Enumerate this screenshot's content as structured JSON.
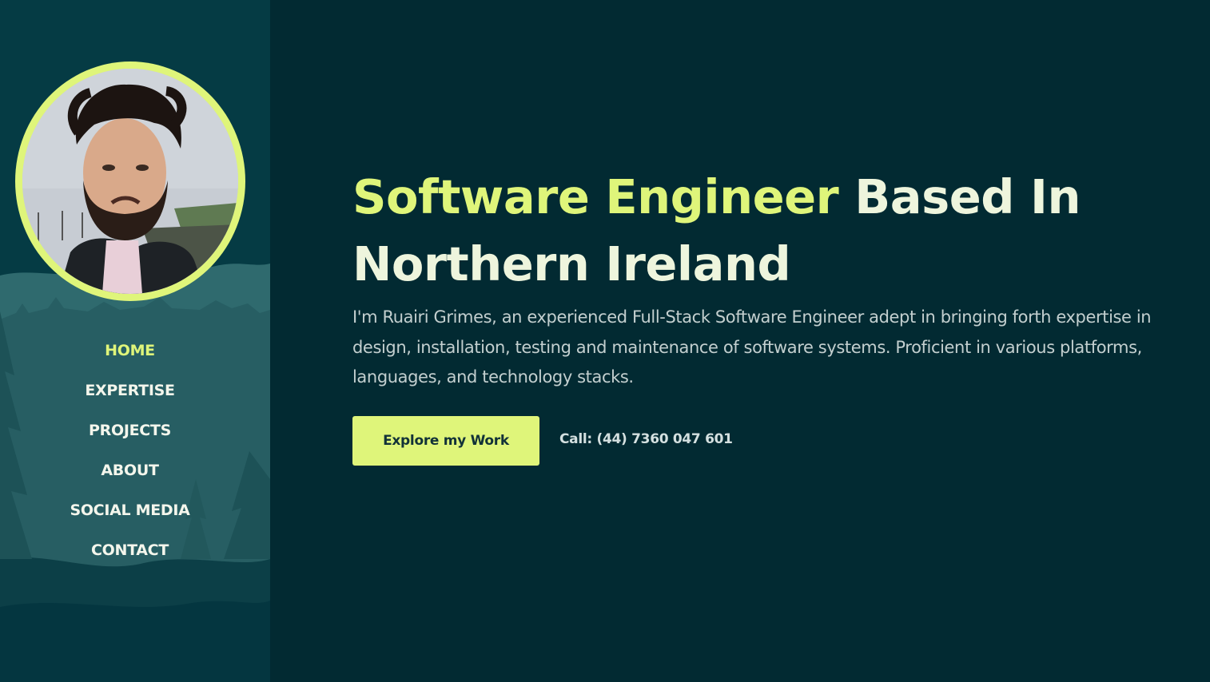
{
  "colors": {
    "background": "#022a32",
    "sidebar": "#053b44",
    "accent": "#dff57a",
    "headline_text": "#eef5dd",
    "body_text": "#c3cfcf"
  },
  "nav": {
    "items": [
      {
        "label": "HOME",
        "active": true
      },
      {
        "label": "EXPERTISE"
      },
      {
        "label": "PROJECTS"
      },
      {
        "label": "ABOUT"
      },
      {
        "label": "SOCIAL MEDIA"
      },
      {
        "label": "CONTACT"
      }
    ]
  },
  "hero": {
    "headline_highlight": "Software Engineer",
    "headline_rest": " Based In Northern Ireland",
    "intro": "I'm Ruairi Grimes, an experienced Full-Stack Software Engineer adept in bringing forth expertise in design, installation, testing and maintenance of software systems. Proficient in various platforms, languages, and technology stacks.",
    "cta_label": "Explore my Work",
    "phone": "Call: (44) 7360 047 601"
  }
}
